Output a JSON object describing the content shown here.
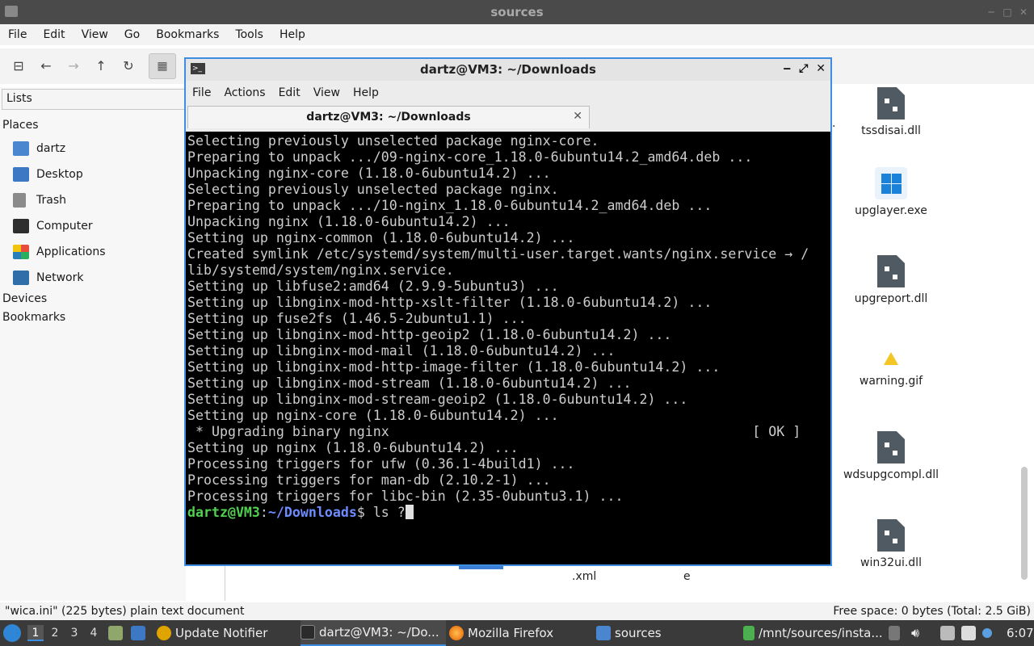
{
  "file_manager": {
    "title": "sources",
    "menu": [
      "File",
      "Edit",
      "View",
      "Go",
      "Bookmarks",
      "Tools",
      "Help"
    ],
    "sidebar": {
      "dropdown": "Lists",
      "places_header": "Places",
      "places": [
        "dartz",
        "Desktop",
        "Trash",
        "Computer",
        "Applications",
        "Network"
      ],
      "devices_header": "Devices",
      "bookmarks_header": "Bookmarks"
    },
    "files": [
      {
        "name": "tssdisai.dll",
        "icon": "dll-file-icon"
      },
      {
        "name": "upglayer.exe",
        "icon": "windows-exe-icon"
      },
      {
        "name": "upgreport.dll",
        "icon": "dll-file-icon"
      },
      {
        "name": "warning.gif",
        "icon": "warning-icon"
      },
      {
        "name": "wdsupgcompl.dll",
        "icon": "dll-file-icon"
      },
      {
        "name": "win32ui.dll",
        "icon": "dll-file-icon"
      }
    ],
    "partial_labels": {
      "xml": ".xml",
      "e": "e",
      "dot": "."
    },
    "status_left": "\"wica.ini\" (225 bytes) plain text document",
    "status_right": "Free space: 0 bytes (Total: 2.5 GiB)"
  },
  "terminal": {
    "title": "dartz@VM3: ~/Downloads",
    "menu": [
      "File",
      "Actions",
      "Edit",
      "View",
      "Help"
    ],
    "tab_title": "dartz@VM3: ~/Downloads",
    "lines": [
      "Selecting previously unselected package nginx-core.",
      "Preparing to unpack .../09-nginx-core_1.18.0-6ubuntu14.2_amd64.deb ...",
      "Unpacking nginx-core (1.18.0-6ubuntu14.2) ...",
      "Selecting previously unselected package nginx.",
      "Preparing to unpack .../10-nginx_1.18.0-6ubuntu14.2_amd64.deb ...",
      "Unpacking nginx (1.18.0-6ubuntu14.2) ...",
      "Setting up nginx-common (1.18.0-6ubuntu14.2) ...",
      "Created symlink /etc/systemd/system/multi-user.target.wants/nginx.service → /",
      "lib/systemd/system/nginx.service.",
      "Setting up libfuse2:amd64 (2.9.9-5ubuntu3) ...",
      "Setting up libnginx-mod-http-xslt-filter (1.18.0-6ubuntu14.2) ...",
      "Setting up fuse2fs (1.46.5-2ubuntu1.1) ...",
      "Setting up libnginx-mod-http-geoip2 (1.18.0-6ubuntu14.2) ...",
      "Setting up libnginx-mod-mail (1.18.0-6ubuntu14.2) ...",
      "Setting up libnginx-mod-http-image-filter (1.18.0-6ubuntu14.2) ...",
      "Setting up libnginx-mod-stream (1.18.0-6ubuntu14.2) ...",
      "Setting up libnginx-mod-stream-geoip2 (1.18.0-6ubuntu14.2) ...",
      "Setting up nginx-core (1.18.0-6ubuntu14.2) ...",
      " * Upgrading binary nginx                                             [ OK ]",
      "Setting up nginx (1.18.0-6ubuntu14.2) ...",
      "Processing triggers for ufw (0.36.1-4build1) ...",
      "Processing triggers for man-db (2.10.2-1) ...",
      "Processing triggers for libc-bin (2.35-0ubuntu3.1) ..."
    ],
    "prompt_user": "dartz@VM3",
    "prompt_sep": ":",
    "prompt_path": "~/Downloads",
    "prompt_symbol": "$ ",
    "command": "ls ?"
  },
  "taskbar": {
    "workspaces": [
      "1",
      "2",
      "3",
      "4"
    ],
    "tasks": [
      "Update Notifier",
      "dartz@VM3: ~/Do...",
      "Mozilla Firefox",
      "sources",
      "/mnt/sources/insta..."
    ],
    "clock": "6:07"
  },
  "colors": {
    "accent": "#3d8ee0",
    "prompt_user": "#4fd04f",
    "prompt_path": "#6c8cff"
  }
}
